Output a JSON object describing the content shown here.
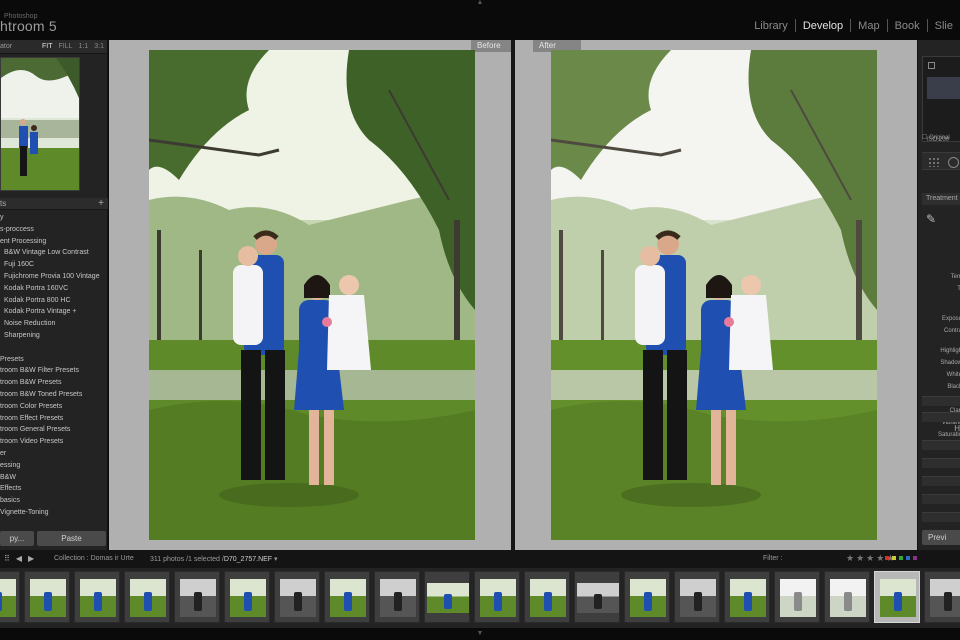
{
  "app": {
    "subtitle": "Photoshop",
    "title": "htroom 5"
  },
  "modules": [
    {
      "label": "Library",
      "active": false
    },
    {
      "label": "Develop",
      "active": true
    },
    {
      "label": "Map",
      "active": false
    },
    {
      "label": "Book",
      "active": false
    },
    {
      "label": "Slie",
      "active": false
    }
  ],
  "navigator": {
    "title": "ator",
    "zoom": [
      "FIT",
      "FILL",
      "1:1",
      "3:1"
    ],
    "active_zoom": "FIT"
  },
  "presets": {
    "header": "ts",
    "add": "+",
    "items": [
      {
        "label": "y",
        "sub": false
      },
      {
        "label": "s-proccess",
        "sub": false
      },
      {
        "label": "ent Processing",
        "sub": false
      },
      {
        "label": "B&W Vintage Low Contrast",
        "sub": true
      },
      {
        "label": "Fuji 160C",
        "sub": true
      },
      {
        "label": "Fujichrome Provia 100 Vintage",
        "sub": true
      },
      {
        "label": "Kodak Portra 160VC",
        "sub": true
      },
      {
        "label": "Kodak Portra 800 HC",
        "sub": true
      },
      {
        "label": "Kodak Portra Vintage  +",
        "sub": true
      },
      {
        "label": "Noise Reduction",
        "sub": true
      },
      {
        "label": "Sharpening",
        "sub": true
      },
      {
        "label": "",
        "sub": false
      },
      {
        "label": "Presets",
        "sub": false
      },
      {
        "label": "troom B&W Filter Presets",
        "sub": false
      },
      {
        "label": "troom B&W Presets",
        "sub": false
      },
      {
        "label": "troom B&W Toned Presets",
        "sub": false
      },
      {
        "label": "troom Color Presets",
        "sub": false
      },
      {
        "label": "troom Effect Presets",
        "sub": false
      },
      {
        "label": "troom General Presets",
        "sub": false
      },
      {
        "label": "troom Video Presets",
        "sub": false
      },
      {
        "label": "er",
        "sub": false
      },
      {
        "label": "essing",
        "sub": false
      },
      {
        "label": "B&W",
        "sub": false
      },
      {
        "label": "Effects",
        "sub": false
      },
      {
        "label": "basics",
        "sub": false
      },
      {
        "label": "Vignette-Toning",
        "sub": false
      }
    ]
  },
  "left_buttons": {
    "copy": "py...",
    "paste": "Paste"
  },
  "compare": {
    "before": "Before",
    "after": "After"
  },
  "right_panel": {
    "iso": "ISO 200",
    "original": "Original",
    "treatment": "Treatment",
    "labels": [
      "Tem",
      "Ti",
      "Exposu",
      "Contra",
      "Highligh",
      "Shadow",
      "White",
      "Black",
      "Clari",
      "Vibranc",
      "Saturatio"
    ],
    "hs_label": "H",
    "previous": "Previ"
  },
  "filmbar": {
    "collection": "Collection : Domas ir Urte",
    "count": "311 photos /1 selected /",
    "filename": "D70_2757.NEF",
    "filename_suffix": " ▾",
    "filter": "Filter :"
  },
  "filmstrip": {
    "thumbs": [
      {
        "tone": "color",
        "orient": "portrait",
        "selected": false
      },
      {
        "tone": "color",
        "orient": "portrait",
        "selected": false
      },
      {
        "tone": "color",
        "orient": "portrait",
        "selected": false
      },
      {
        "tone": "color",
        "orient": "portrait",
        "selected": false
      },
      {
        "tone": "bw",
        "orient": "portrait",
        "selected": false
      },
      {
        "tone": "color",
        "orient": "portrait",
        "selected": false
      },
      {
        "tone": "bw",
        "orient": "portrait",
        "selected": false
      },
      {
        "tone": "color",
        "orient": "portrait",
        "selected": false
      },
      {
        "tone": "bw",
        "orient": "portrait",
        "selected": false
      },
      {
        "tone": "color",
        "orient": "landscape",
        "selected": false
      },
      {
        "tone": "color",
        "orient": "portrait",
        "selected": false
      },
      {
        "tone": "color",
        "orient": "portrait",
        "selected": false
      },
      {
        "tone": "bw",
        "orient": "landscape",
        "selected": false
      },
      {
        "tone": "color",
        "orient": "portrait",
        "selected": false
      },
      {
        "tone": "bw",
        "orient": "portrait",
        "selected": false
      },
      {
        "tone": "color",
        "orient": "portrait",
        "selected": false
      },
      {
        "tone": "light",
        "orient": "portrait",
        "selected": false
      },
      {
        "tone": "light",
        "orient": "portrait",
        "selected": false
      },
      {
        "tone": "color",
        "orient": "portrait",
        "selected": true
      },
      {
        "tone": "bw",
        "orient": "portrait",
        "selected": false
      }
    ]
  },
  "colors": {
    "panel": "#232323",
    "center_bg": "#b0b0b0",
    "grass": "#5f8a2a",
    "shirt": "#1f4fb0"
  }
}
